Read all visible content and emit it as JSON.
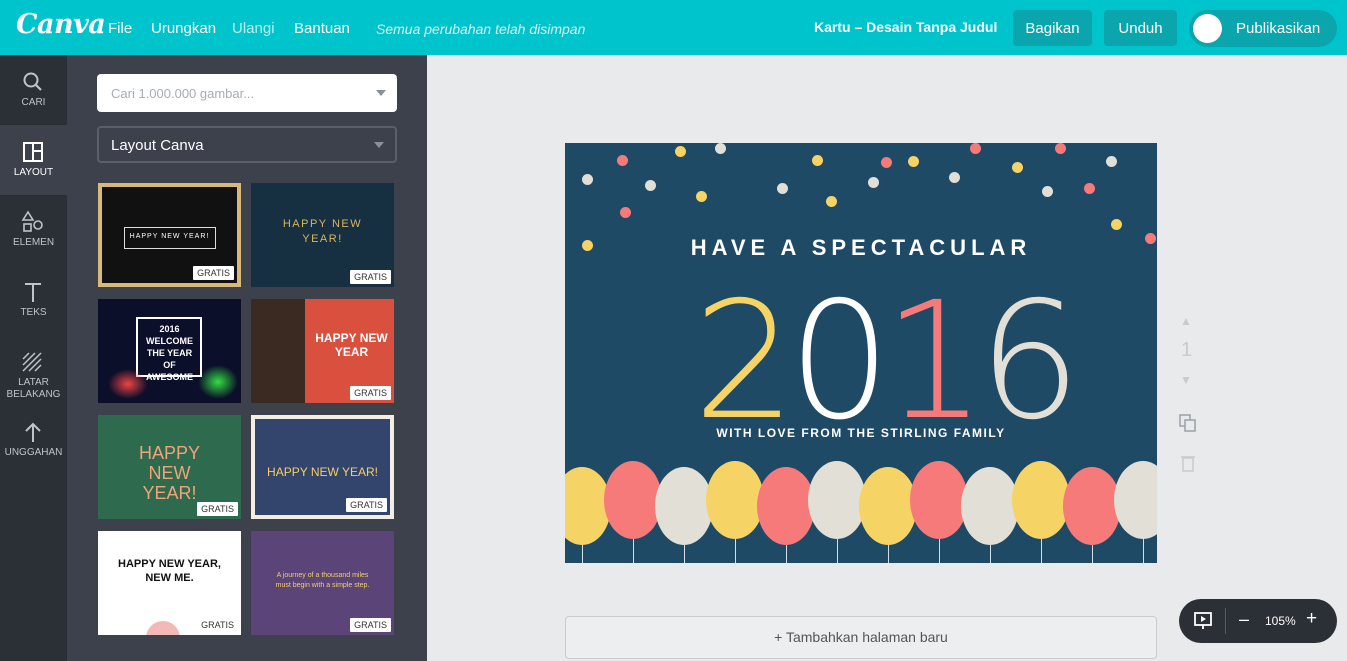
{
  "topbar": {
    "logo": "Canva",
    "menu": [
      "File",
      "Urungkan",
      "Ulangi",
      "Bantuan"
    ],
    "status": "Semua perubahan telah disimpan",
    "doc_title": "Kartu – Desain Tanpa Judul",
    "share_label": "Bagikan",
    "download_label": "Unduh",
    "publish_label": "Publikasikan",
    "accent_color": "#00c4cc"
  },
  "rail": [
    {
      "label": "CARI",
      "icon": "search-icon"
    },
    {
      "label": "LAYOUT",
      "icon": "layout-icon"
    },
    {
      "label": "ELEMEN",
      "icon": "shapes-icon"
    },
    {
      "label": "TEKS",
      "icon": "text-icon"
    },
    {
      "label": "LATAR BELAKANG",
      "icon": "background-icon"
    },
    {
      "label": "UNGGAHAN",
      "icon": "upload-icon"
    }
  ],
  "panel": {
    "search_placeholder": "Cari 1.000.000 gambar...",
    "layout_select": "Layout Canva",
    "badge": "GRATIS",
    "templates": [
      {
        "text": "HAPPY NEW YEAR!"
      },
      {
        "text": "HAPPY NEW YEAR!"
      },
      {
        "text": "2016 WELCOME THE YEAR OF AWESOME"
      },
      {
        "text": "HAPPY NEW YEAR"
      },
      {
        "text": "HAPPY NEW YEAR!"
      },
      {
        "text": "HAPPY NEW YEAR!"
      },
      {
        "text": "HAPPY NEW YEAR, NEW ME."
      },
      {
        "text": "A journey of a thousand miles must begin with a simple step."
      }
    ]
  },
  "design": {
    "headline": "HAVE A SPECTACULAR",
    "year_digits": [
      "2",
      "0",
      "1",
      "6"
    ],
    "subline": "WITH LOVE FROM THE STIRLING FAMILY",
    "background": "#1f4a65"
  },
  "page_controls": {
    "page_number": "1"
  },
  "add_page": "+ Tambahkan halaman baru",
  "zoom": {
    "level": "105%",
    "minus": "–",
    "plus": "+"
  }
}
